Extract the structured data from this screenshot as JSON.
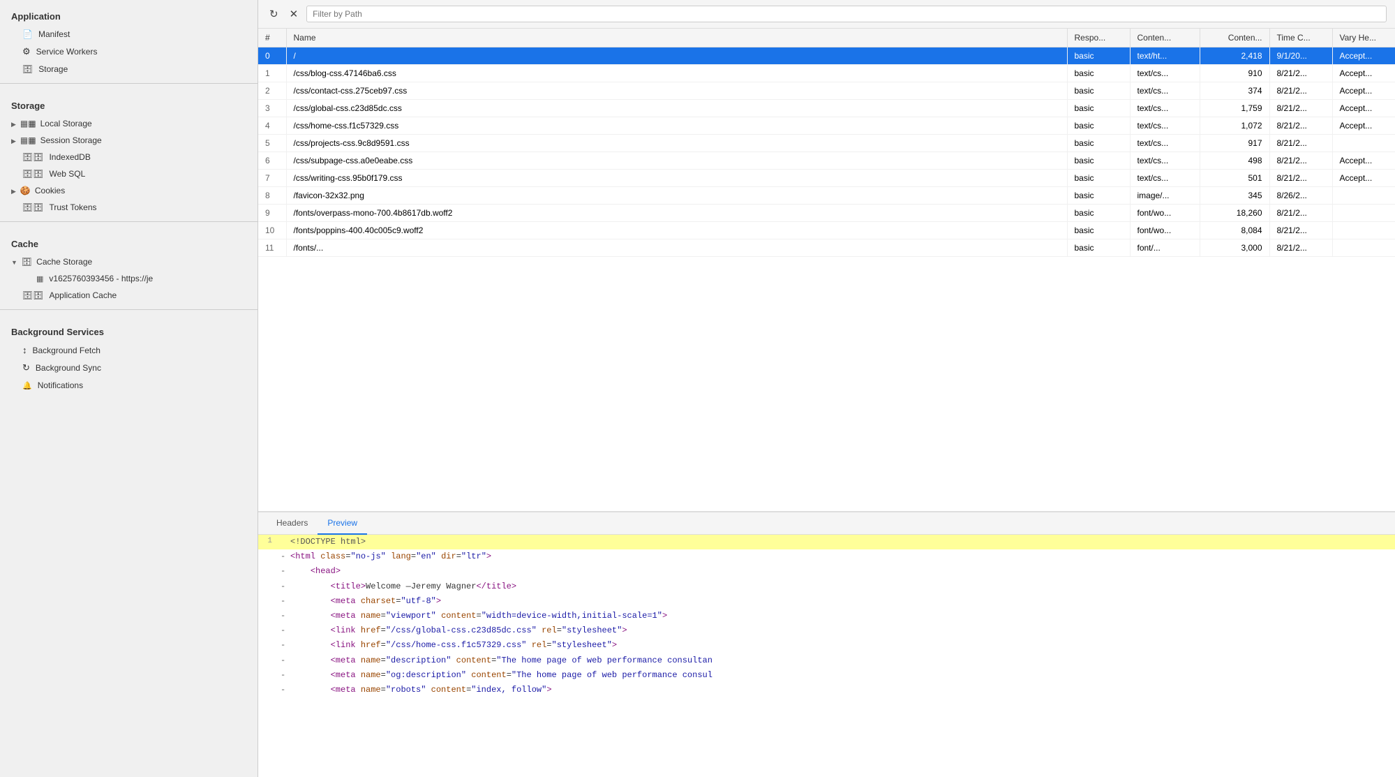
{
  "sidebar": {
    "sections": [
      {
        "id": "application",
        "label": "Application",
        "items": [
          {
            "id": "manifest",
            "label": "Manifest",
            "icon": "manifest",
            "level": 1
          },
          {
            "id": "service-workers",
            "label": "Service Workers",
            "icon": "gear",
            "level": 1
          },
          {
            "id": "storage",
            "label": "Storage",
            "icon": "db",
            "level": 1
          }
        ]
      },
      {
        "id": "storage-section",
        "label": "Storage",
        "items": [
          {
            "id": "local-storage",
            "label": "Local Storage",
            "icon": "grid",
            "level": 1,
            "expandable": true,
            "expanded": false
          },
          {
            "id": "session-storage",
            "label": "Session Storage",
            "icon": "grid",
            "level": 1,
            "expandable": true,
            "expanded": false
          },
          {
            "id": "indexeddb",
            "label": "IndexedDB",
            "icon": "db",
            "level": 1
          },
          {
            "id": "web-sql",
            "label": "Web SQL",
            "icon": "db",
            "level": 1
          },
          {
            "id": "cookies",
            "label": "Cookies",
            "icon": "cookie",
            "level": 1,
            "expandable": true,
            "expanded": false
          },
          {
            "id": "trust-tokens",
            "label": "Trust Tokens",
            "icon": "db",
            "level": 1
          }
        ]
      },
      {
        "id": "cache-section",
        "label": "Cache",
        "items": [
          {
            "id": "cache-storage",
            "label": "Cache Storage",
            "icon": "cache",
            "level": 1,
            "expandable": true,
            "expanded": true
          },
          {
            "id": "cache-entry",
            "label": "v1625760393456 - https://je",
            "icon": "grid",
            "level": 2
          },
          {
            "id": "application-cache",
            "label": "Application Cache",
            "icon": "db",
            "level": 1
          }
        ]
      },
      {
        "id": "background-services",
        "label": "Background Services",
        "items": [
          {
            "id": "background-fetch",
            "label": "Background Fetch",
            "icon": "fetch",
            "level": 1
          },
          {
            "id": "background-sync",
            "label": "Background Sync",
            "icon": "sync",
            "level": 1
          },
          {
            "id": "notifications",
            "label": "Notifications",
            "icon": "bell",
            "level": 1
          }
        ]
      }
    ]
  },
  "toolbar": {
    "refresh_icon": "↻",
    "close_icon": "✕",
    "filter_placeholder": "Filter by Path"
  },
  "table": {
    "columns": [
      "#",
      "Name",
      "Respo...",
      "Conten...",
      "Conten...",
      "Time C...",
      "Vary He..."
    ],
    "rows": [
      {
        "num": "0",
        "name": "/",
        "response": "basic",
        "content_type": "text/ht...",
        "content_length": "2,418",
        "time": "9/1/20...",
        "vary": "Accept...",
        "selected": true
      },
      {
        "num": "1",
        "name": "/css/blog-css.47146ba6.css",
        "response": "basic",
        "content_type": "text/cs...",
        "content_length": "910",
        "time": "8/21/2...",
        "vary": "Accept..."
      },
      {
        "num": "2",
        "name": "/css/contact-css.275ceb97.css",
        "response": "basic",
        "content_type": "text/cs...",
        "content_length": "374",
        "time": "8/21/2...",
        "vary": "Accept..."
      },
      {
        "num": "3",
        "name": "/css/global-css.c23d85dc.css",
        "response": "basic",
        "content_type": "text/cs...",
        "content_length": "1,759",
        "time": "8/21/2...",
        "vary": "Accept..."
      },
      {
        "num": "4",
        "name": "/css/home-css.f1c57329.css",
        "response": "basic",
        "content_type": "text/cs...",
        "content_length": "1,072",
        "time": "8/21/2...",
        "vary": "Accept..."
      },
      {
        "num": "5",
        "name": "/css/projects-css.9c8d9591.css",
        "response": "basic",
        "content_type": "text/cs...",
        "content_length": "917",
        "time": "8/21/2...",
        "vary": ""
      },
      {
        "num": "6",
        "name": "/css/subpage-css.a0e0eabe.css",
        "response": "basic",
        "content_type": "text/cs...",
        "content_length": "498",
        "time": "8/21/2...",
        "vary": "Accept..."
      },
      {
        "num": "7",
        "name": "/css/writing-css.95b0f179.css",
        "response": "basic",
        "content_type": "text/cs...",
        "content_length": "501",
        "time": "8/21/2...",
        "vary": "Accept..."
      },
      {
        "num": "8",
        "name": "/favicon-32x32.png",
        "response": "basic",
        "content_type": "image/...",
        "content_length": "345",
        "time": "8/26/2...",
        "vary": ""
      },
      {
        "num": "9",
        "name": "/fonts/overpass-mono-700.4b8617db.woff2",
        "response": "basic",
        "content_type": "font/wo...",
        "content_length": "18,260",
        "time": "8/21/2...",
        "vary": ""
      },
      {
        "num": "10",
        "name": "/fonts/poppins-400.40c005c9.woff2",
        "response": "basic",
        "content_type": "font/wo...",
        "content_length": "8,084",
        "time": "8/21/2...",
        "vary": ""
      },
      {
        "num": "11",
        "name": "/fonts/...",
        "response": "basic",
        "content_type": "font/...",
        "content_length": "3,000",
        "time": "8/21/2...",
        "vary": ""
      }
    ]
  },
  "preview": {
    "tabs": [
      {
        "id": "headers",
        "label": "Headers"
      },
      {
        "id": "preview",
        "label": "Preview",
        "active": true
      }
    ],
    "code_lines": [
      {
        "num": "1",
        "dash": "",
        "content": "<!DOCTYPE html>",
        "highlighted": true,
        "tags": [
          {
            "text": "<!DOCTYPE html>",
            "class": "doctype"
          }
        ]
      },
      {
        "num": "",
        "dash": "-",
        "content": "<html class=\"no-js\" lang=\"en\" dir=\"ltr\">",
        "highlighted": false
      },
      {
        "num": "",
        "dash": "-",
        "content": "    <head>",
        "highlighted": false
      },
      {
        "num": "",
        "dash": "-",
        "content": "        <title>Welcome &mdash;Jeremy Wagner</title>",
        "highlighted": false
      },
      {
        "num": "",
        "dash": "-",
        "content": "        <meta charset=\"utf-8\">",
        "highlighted": false
      },
      {
        "num": "",
        "dash": "-",
        "content": "        <meta name=\"viewport\" content=\"width=device-width,initial-scale=1\">",
        "highlighted": false
      },
      {
        "num": "",
        "dash": "-",
        "content": "        <link href=\"/css/global-css.c23d85dc.css\" rel=\"stylesheet\">",
        "highlighted": false
      },
      {
        "num": "",
        "dash": "-",
        "content": "        <link href=\"/css/home-css.f1c57329.css\" rel=\"stylesheet\">",
        "highlighted": false
      },
      {
        "num": "",
        "dash": "-",
        "content": "        <meta name=\"description\" content=\"The home page of web performance consultan",
        "highlighted": false
      },
      {
        "num": "",
        "dash": "-",
        "content": "        <meta name=\"og:description\" content=\"The home page of web performance consul",
        "highlighted": false
      },
      {
        "num": "",
        "dash": "-",
        "content": "        <meta name=\"robots\" content=\"index, follow\">",
        "highlighted": false
      }
    ]
  }
}
